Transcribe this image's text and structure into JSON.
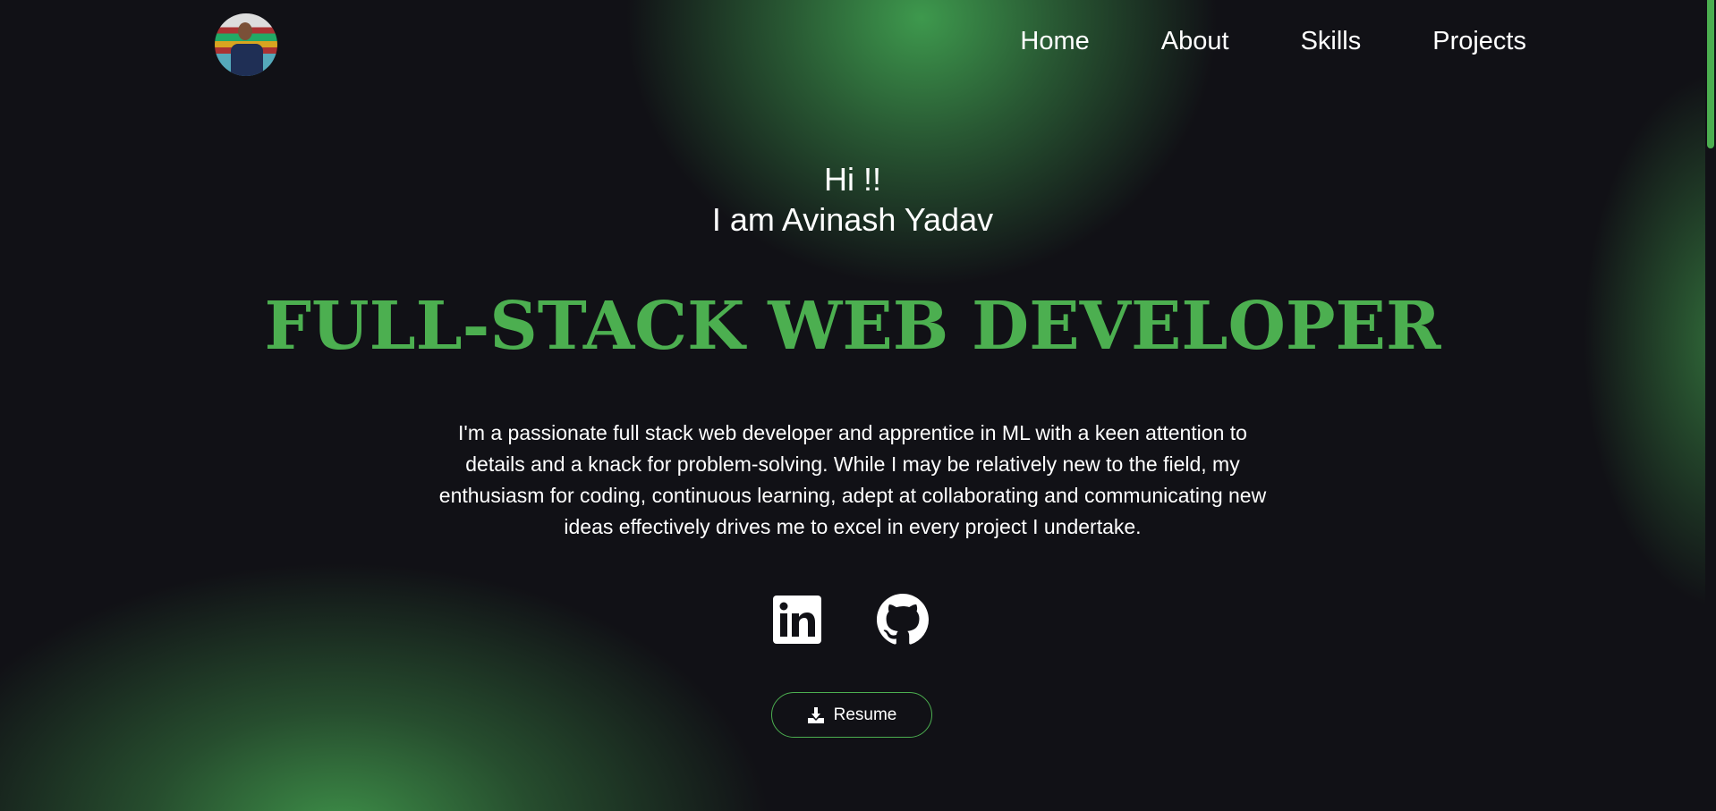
{
  "nav": {
    "items": [
      "Home",
      "About",
      "Skills",
      "Projects"
    ]
  },
  "hero": {
    "greeting": "Hi !!",
    "intro": "I am Avinash Yadav",
    "title": "FULL-STACK WEB DEVELOPER",
    "description": "I'm a passionate full stack web developer and apprentice in ML with a keen attention to details and a knack for problem-solving. While I may be relatively new to the field, my enthusiasm for coding, continuous learning, adept at collaborating and communicating new ideas effectively drives me to excel in every project I undertake.",
    "resume_label": "Resume"
  },
  "colors": {
    "accent": "#4caf50",
    "background": "#111116"
  }
}
